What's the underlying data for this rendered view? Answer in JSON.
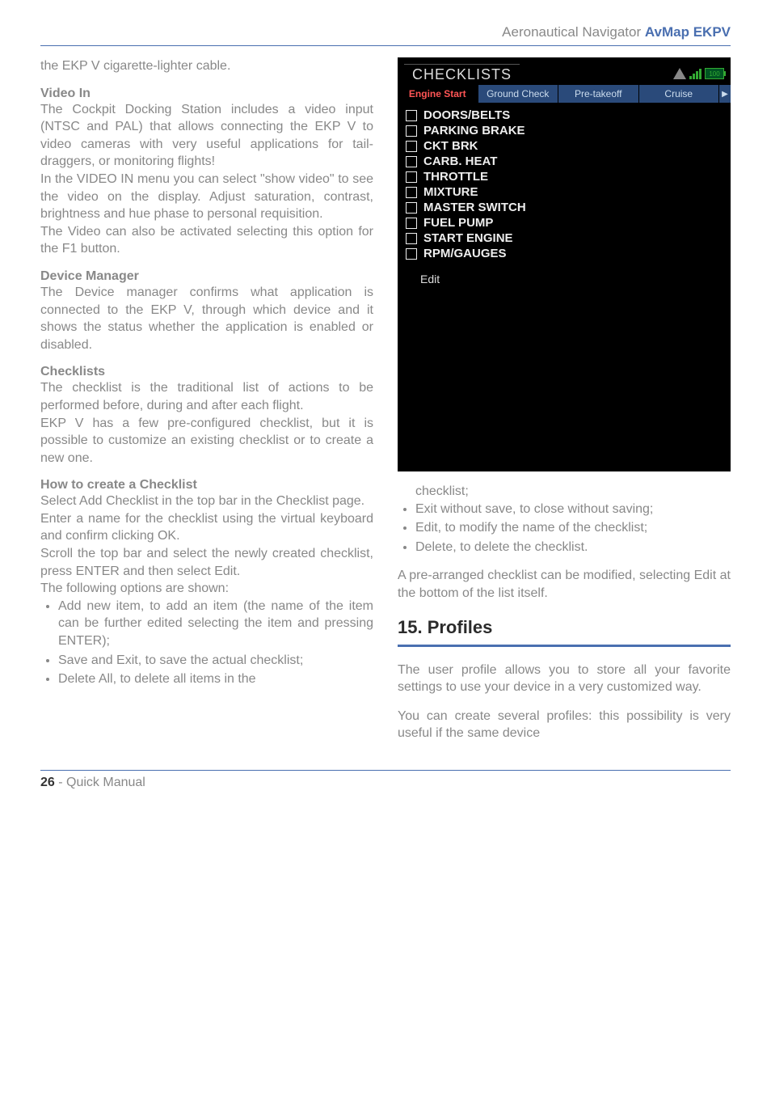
{
  "header": {
    "product": "Aeronautical Navigator ",
    "brand": "AvMap EKPV"
  },
  "left": {
    "intro_cont": "the EKP V cigarette-lighter cable.",
    "video_in_head": "Video In",
    "video_in_p1": "The Cockpit Docking Station includes a video input (NTSC and PAL) that allows connecting the EKP V to video cameras with very useful applications for tail-draggers, or monitoring flights!",
    "video_in_p2": "In the VIDEO IN menu you can select \"show video\" to see the video on the display. Adjust saturation, contrast, brightness and hue phase to personal requisition.",
    "video_in_p3": "The Video can also be activated selecting this option for the F1 button.",
    "devmgr_head": "Device Manager",
    "devmgr_p": "The Device manager confirms what application is connected to the EKP V, through which device and it shows the status whether the application is enabled or disabled.",
    "check_head": "Checklists",
    "check_p1": "The checklist is the traditional list of actions to be performed before, during and after each flight.",
    "check_p2": "EKP V has a few pre-configured checklist, but it is possible to customize an existing checklist or to create a new one.",
    "howto_head": "How to create a Checklist",
    "howto_p1": "Select Add Checklist in the top bar in the Checklist page.",
    "howto_p2": "Enter a name for the checklist using the virtual keyboard and confirm clicking OK.",
    "howto_p3": "Scroll the top bar and select the newly created checklist, press ENTER and then select Edit.",
    "howto_p4": "The following options are shown:",
    "howto_items": [
      "Add new item, to add an item (the name of the item can be further edited selecting the item and pressing ENTER);",
      "Save and Exit, to save the actual checklist;",
      "Delete All, to delete all items in the"
    ]
  },
  "shot": {
    "title": "CHECKLISTS",
    "battery": "100",
    "tabs": [
      "Engine Start",
      "Ground Check",
      "Pre-takeoff",
      "Cruise"
    ],
    "items": [
      "DOORS/BELTS",
      "PARKING BRAKE",
      "CKT BRK",
      "CARB. HEAT",
      "THROTTLE",
      "MIXTURE",
      "MASTER SWITCH",
      "FUEL PUMP",
      "START ENGINE",
      "RPM/GAUGES"
    ],
    "edit": "Edit"
  },
  "right": {
    "cont_first": "checklist;",
    "cont_items": [
      "Exit without save, to close without saving;",
      "Edit, to modify the name of the checklist;",
      "Delete, to delete the checklist."
    ],
    "mod_p": "A pre-arranged checklist can be modified, selecting Edit at the bottom of the list itself.",
    "section_title": "15.  Profiles",
    "profiles_p1": "The user profile allows you to store all your favorite settings to use your device in a very customized way.",
    "profiles_p2": "You can create several profiles: this possibility is very useful if the same device"
  },
  "footer": {
    "page": "26",
    "label": " - Quick Manual"
  }
}
